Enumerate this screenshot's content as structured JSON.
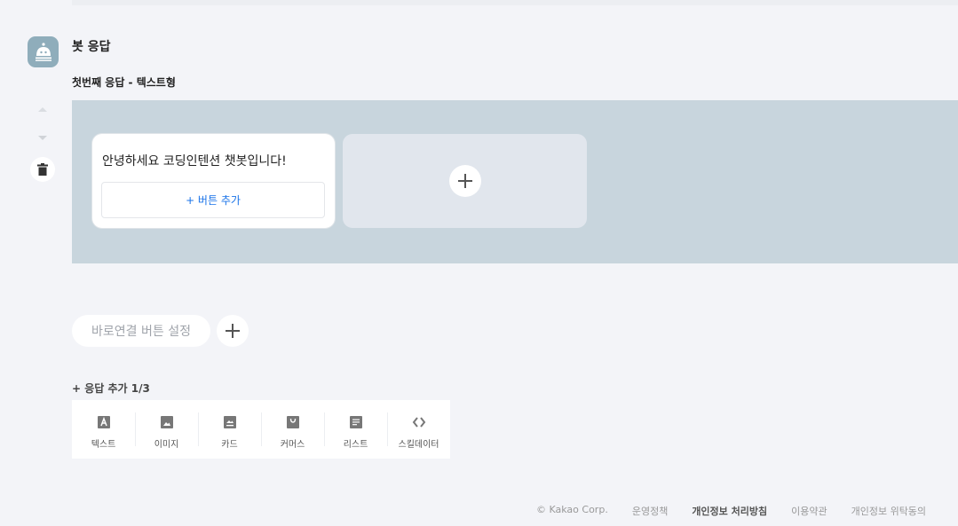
{
  "section": {
    "title": "봇 응답"
  },
  "response": {
    "subtitle": "첫번째 응답 - 텍스트형",
    "bubble_text": "안녕하세요 코딩인텐션 챗봇입니다!",
    "add_button_label": "+ 버튼 추가"
  },
  "quick_reply": {
    "label": "바로연결 버튼 설정"
  },
  "add_response": {
    "label": "+ 응답 추가 1/3",
    "types": [
      {
        "label": "텍스트",
        "icon": "text-icon"
      },
      {
        "label": "이미지",
        "icon": "image-icon"
      },
      {
        "label": "카드",
        "icon": "card-icon"
      },
      {
        "label": "커머스",
        "icon": "commerce-icon"
      },
      {
        "label": "리스트",
        "icon": "list-icon"
      },
      {
        "label": "스킬데이터",
        "icon": "code-icon"
      }
    ]
  },
  "footer": {
    "copyright": "© Kakao Corp.",
    "links": [
      "운영정책",
      "개인정보 처리방침",
      "이용약관",
      "개인정보 위탁동의"
    ]
  },
  "colors": {
    "link_blue": "#1a73e8",
    "canvas_bg": "#c8d5dd",
    "avatar_bg": "#8fadbb"
  }
}
